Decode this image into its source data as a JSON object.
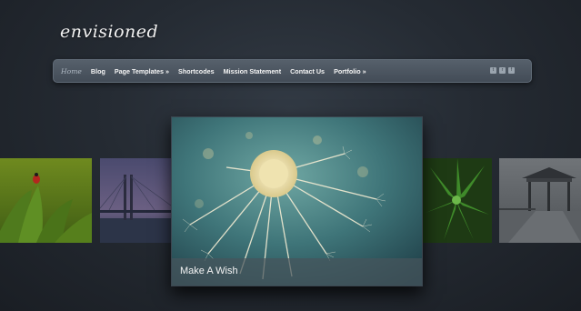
{
  "site": {
    "logo": "envisioned"
  },
  "nav": {
    "items": [
      {
        "label": "Home"
      },
      {
        "label": "Blog"
      },
      {
        "label": "Page Templates »"
      },
      {
        "label": "Shortcodes"
      },
      {
        "label": "Mission Statement"
      },
      {
        "label": "Contact Us"
      },
      {
        "label": "Portfolio »"
      }
    ],
    "social": [
      {
        "icon": "twitter-icon",
        "glyph": "t"
      },
      {
        "icon": "rss-icon",
        "glyph": "r"
      },
      {
        "icon": "facebook-icon",
        "glyph": "f"
      }
    ]
  },
  "slider": {
    "featured_caption": "Make A Wish",
    "slides": [
      {
        "icon": "ladybug-photo"
      },
      {
        "icon": "bridge-photo"
      },
      {
        "icon": "dandelion-photo"
      },
      {
        "icon": "green-plant-photo"
      },
      {
        "icon": "gazebo-photo"
      }
    ]
  },
  "colors": {
    "background": "#252b33",
    "navbar": "#4b545f",
    "nav_text": "#f4f4f4",
    "nav_active": "#aeb8c3"
  }
}
